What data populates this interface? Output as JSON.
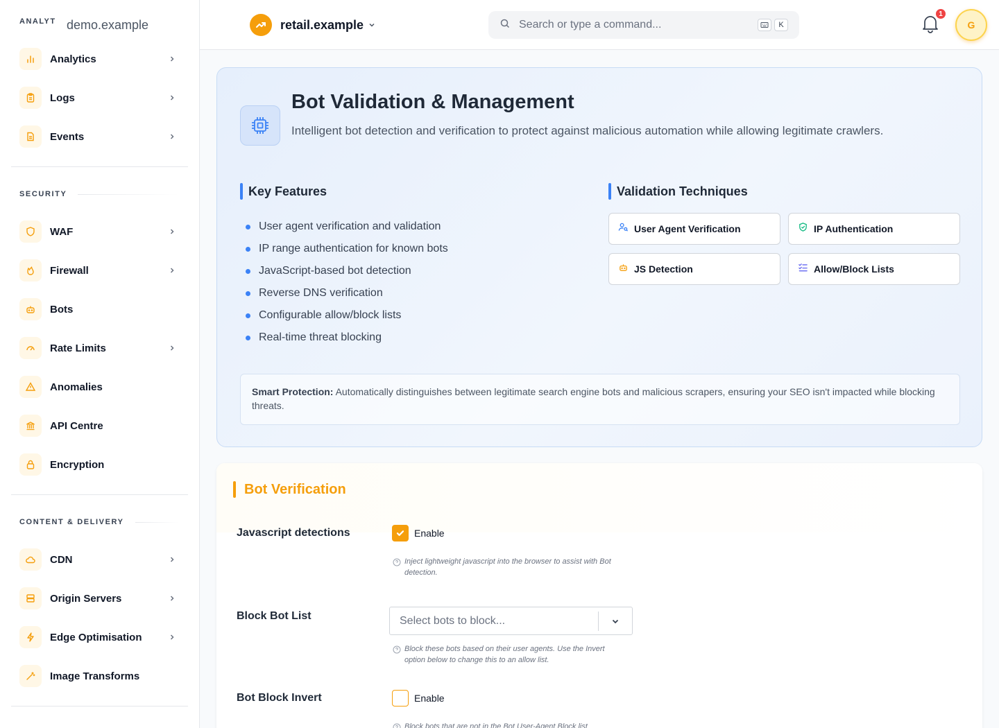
{
  "sidebar": {
    "brand_text": "ANALYT",
    "domain": "demo.example",
    "top_items": [
      {
        "label": "Analytics",
        "icon": "bar-chart-icon",
        "has_chevron": true
      },
      {
        "label": "Logs",
        "icon": "clipboard-icon",
        "has_chevron": true
      },
      {
        "label": "Events",
        "icon": "document-icon",
        "has_chevron": true
      }
    ],
    "security_heading": "SECURITY",
    "security_items": [
      {
        "label": "WAF",
        "icon": "shield-icon",
        "has_chevron": true
      },
      {
        "label": "Firewall",
        "icon": "flame-icon",
        "has_chevron": true
      },
      {
        "label": "Bots",
        "icon": "bot-icon",
        "has_chevron": false
      },
      {
        "label": "Rate Limits",
        "icon": "gauge-icon",
        "has_chevron": true
      },
      {
        "label": "Anomalies",
        "icon": "warning-icon",
        "has_chevron": false
      },
      {
        "label": "API Centre",
        "icon": "bank-icon",
        "has_chevron": false
      },
      {
        "label": "Encryption",
        "icon": "lock-icon",
        "has_chevron": false
      }
    ],
    "content_heading": "CONTENT & DELIVERY",
    "content_items": [
      {
        "label": "CDN",
        "icon": "cloud-icon",
        "has_chevron": true
      },
      {
        "label": "Origin Servers",
        "icon": "server-icon",
        "has_chevron": true
      },
      {
        "label": "Edge Optimisation",
        "icon": "bolt-icon",
        "has_chevron": true
      },
      {
        "label": "Image Transforms",
        "icon": "wand-icon",
        "has_chevron": false
      }
    ]
  },
  "topbar": {
    "site_name": "retail.example",
    "search_placeholder": "Search or type a command...",
    "shortcut_key": "K",
    "notification_count": "1",
    "avatar_initial": "G"
  },
  "hero": {
    "title": "Bot Validation & Management",
    "description": "Intelligent bot detection and verification to protect against malicious automation while allowing legitimate crawlers.",
    "features_heading": "Key Features",
    "features": [
      "User agent verification and validation",
      "IP range authentication for known bots",
      "JavaScript-based bot detection",
      "Reverse DNS verification",
      "Configurable allow/block lists",
      "Real-time threat blocking"
    ],
    "techniques_heading": "Validation Techniques",
    "techniques": [
      {
        "label": "User Agent Verification",
        "icon": "user-search-icon"
      },
      {
        "label": "IP Authentication",
        "icon": "shield-check-icon"
      },
      {
        "label": "JS Detection",
        "icon": "bot-icon"
      },
      {
        "label": "Allow/Block Lists",
        "icon": "list-check-icon"
      }
    ],
    "smart_label": "Smart Protection:",
    "smart_text": " Automatically distinguishes between legitimate search engine bots and malicious scrapers, ensuring your SEO isn't impacted while blocking threats."
  },
  "settings": {
    "title": "Bot Verification",
    "js_detection": {
      "label": "Javascript detections",
      "checkbox_label": "Enable",
      "checked": true,
      "help": "Inject lightweight javascript into the browser to assist with Bot detection."
    },
    "block_list": {
      "label": "Block Bot List",
      "placeholder": "Select bots to block...",
      "help": "Block these bots based on their user agents. Use the Invert option below to change this to an allow list."
    },
    "invert": {
      "label": "Bot Block Invert",
      "checkbox_label": "Enable",
      "checked": false,
      "help": "Block bots that are not in the Bot User-Agent Block list"
    }
  },
  "colors": {
    "accent": "#f59e0b",
    "blue": "#3b82f6",
    "badge": "#ef4444"
  }
}
